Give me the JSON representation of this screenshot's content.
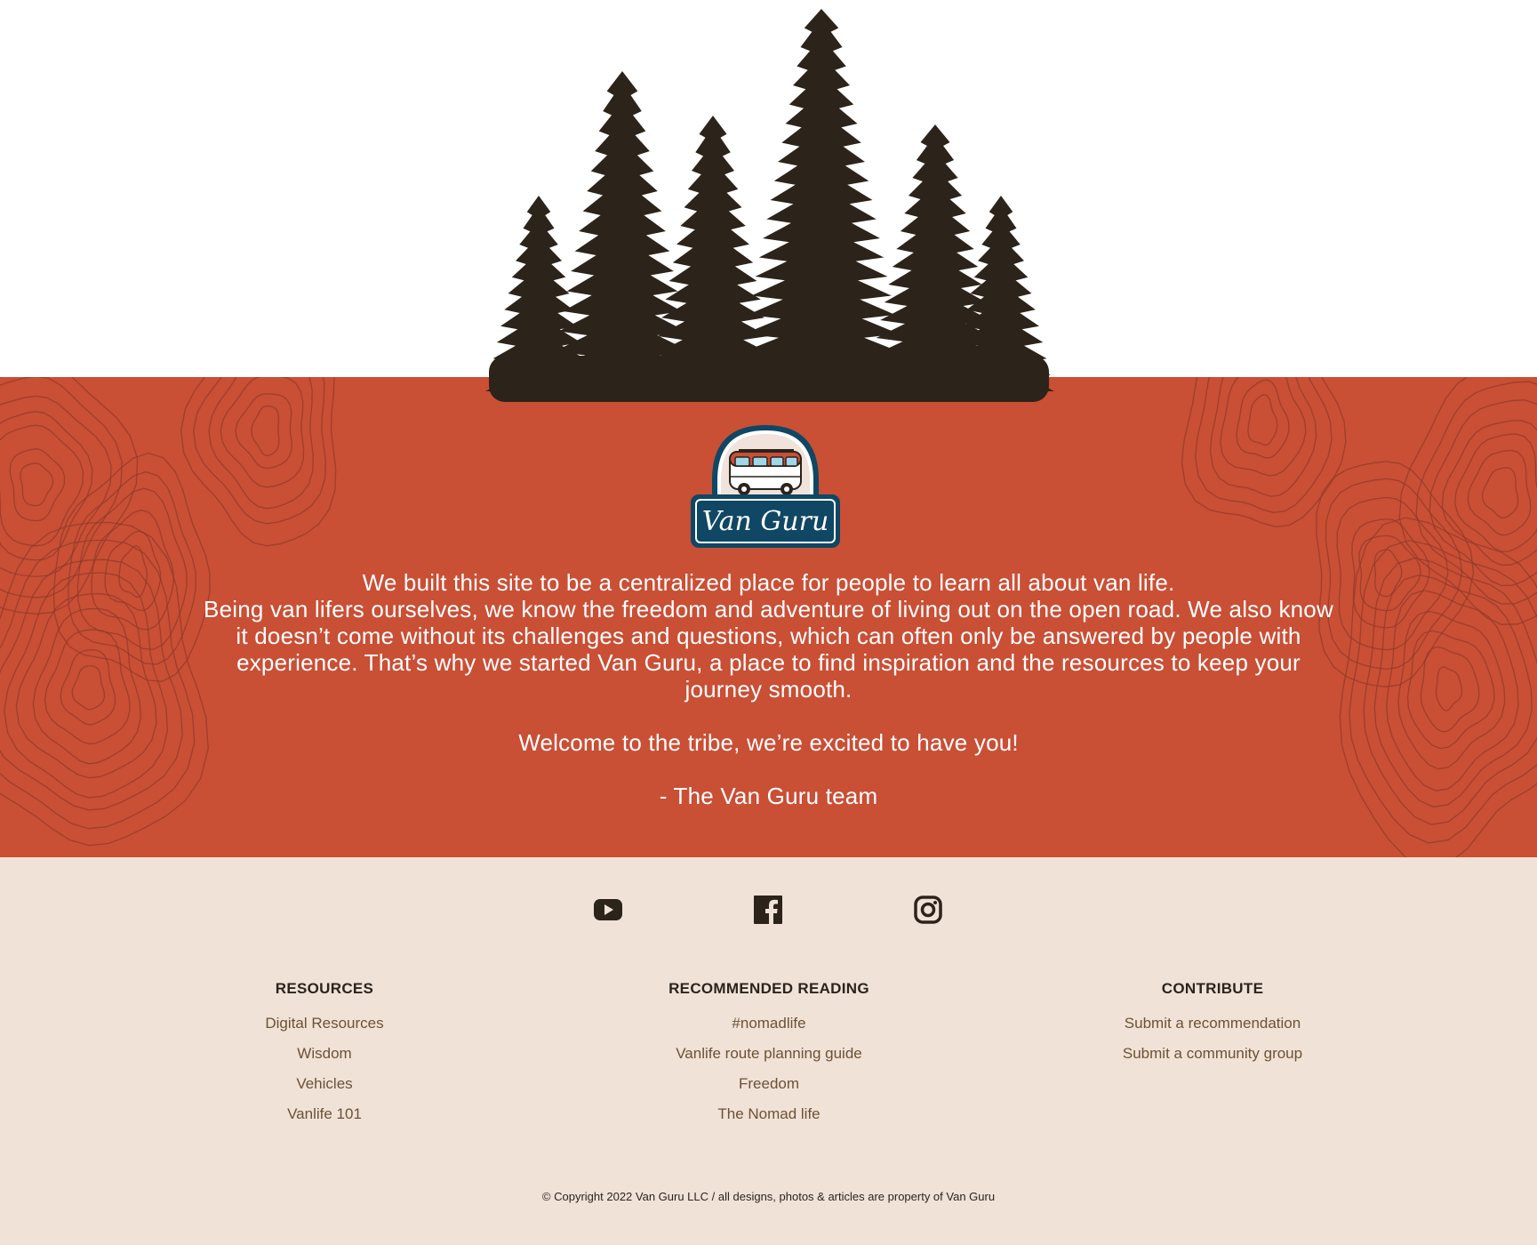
{
  "colors": {
    "band": "#c94f35",
    "topo_line": "#8f3a28",
    "tree": "#2c231a",
    "footer_bg": "#f1e2d8",
    "link": "#6b5234",
    "heading": "#2a241d",
    "logo_navy": "#0f4764"
  },
  "logo": {
    "text": "Van Guru",
    "icon": "camper-van-icon"
  },
  "about": {
    "line1": "We built this site to be a centralized place for people to learn all about van life.",
    "paragraph": "Being van lifers ourselves, we know the freedom and adventure of living out on the open road. We also know it doesn’t come without its challenges and questions, which can often only be answered by people with experience. That’s why we started Van Guru, a place to find inspiration and the resources to keep your journey smooth.",
    "welcome": "Welcome to the tribe, we’re excited to have you!",
    "signoff": "- The Van Guru team"
  },
  "social": [
    {
      "name": "youtube",
      "icon": "youtube-icon"
    },
    {
      "name": "facebook",
      "icon": "facebook-icon"
    },
    {
      "name": "instagram",
      "icon": "instagram-icon"
    }
  ],
  "footer": {
    "resources": {
      "title": "RESOURCES",
      "links": [
        "Digital Resources",
        "Wisdom",
        "Vehicles",
        "Vanlife 101"
      ]
    },
    "reading": {
      "title": "RECOMMENDED READING",
      "links": [
        "#nomadlife",
        "Vanlife route planning guide",
        "Freedom",
        "The Nomad life"
      ]
    },
    "contribute": {
      "title": "CONTRIBUTE",
      "links": [
        "Submit a recommendation",
        "Submit a community group"
      ]
    },
    "copyright": "© Copyright 2022 Van Guru LLC / all designs, photos & articles are property of Van Guru"
  }
}
